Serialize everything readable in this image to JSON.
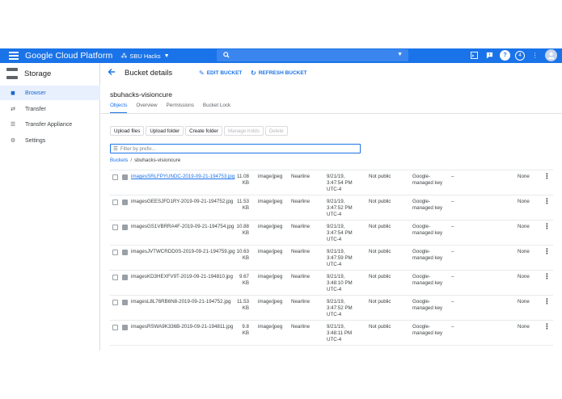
{
  "topbar": {
    "brand": "Google Cloud Platform",
    "project": "SBU Hacks",
    "notification_count": "4"
  },
  "sidebar": {
    "product_title": "Storage",
    "items": [
      {
        "label": "Browser",
        "icon": "bucket-icon",
        "active": true
      },
      {
        "label": "Transfer",
        "icon": "transfer-icon",
        "active": false
      },
      {
        "label": "Transfer Appliance",
        "icon": "appliance-icon",
        "active": false
      },
      {
        "label": "Settings",
        "icon": "gear-icon",
        "active": false
      }
    ]
  },
  "header": {
    "title": "Bucket details",
    "edit_label": "EDIT BUCKET",
    "refresh_label": "REFRESH BUCKET"
  },
  "bucket": {
    "name": "sbuhacks-visioncure"
  },
  "tabs": [
    {
      "label": "Objects",
      "active": true
    },
    {
      "label": "Overview",
      "active": false
    },
    {
      "label": "Permissions",
      "active": false
    },
    {
      "label": "Bucket Lock",
      "active": false
    }
  ],
  "actions": {
    "upload_files": "Upload files",
    "upload_folder": "Upload folder",
    "create_folder": "Create folder",
    "manage_holds": "Manage holds",
    "delete": "Delete"
  },
  "filter": {
    "placeholder": "Filter by prefix..."
  },
  "breadcrumb": {
    "root": "Buckets",
    "separator": "/",
    "current": "sbuhacks-visioncure"
  },
  "objects": [
    {
      "name": "imagesSRLFPYUNDC-2019-09-21-194753.jpg",
      "size": "11.08",
      "unit": "KB",
      "type": "image/jpeg",
      "storage": "Nearline",
      "date": "9/21/19,",
      "time": "3:47:54 PM",
      "tz": "UTC-4",
      "public": "Not public",
      "enc1": "Google-",
      "enc2": "managed key",
      "retention": "–",
      "hold": "None"
    },
    {
      "name": "imagesGEESJFD1RY-2019-09-21-194752.jpg",
      "size": "11.53",
      "unit": "KB",
      "type": "image/jpeg",
      "storage": "Nearline",
      "date": "9/21/19,",
      "time": "3:47:52 PM",
      "tz": "UTC-4",
      "public": "Not public",
      "enc1": "Google-",
      "enc2": "managed key",
      "retention": "–",
      "hold": "None"
    },
    {
      "name": "imagesGS1VBRRA4F-2019-09-21-194754.jpg",
      "size": "10.88",
      "unit": "KB",
      "type": "image/jpeg",
      "storage": "Nearline",
      "date": "9/21/19,",
      "time": "3:47:54 PM",
      "tz": "UTC-4",
      "public": "Not public",
      "enc1": "Google-",
      "enc2": "managed key",
      "retention": "–",
      "hold": "None"
    },
    {
      "name": "imagesJVTWCRDD0S-2019-09-21-194759.jpg",
      "size": "10.63",
      "unit": "KB",
      "type": "image/jpeg",
      "storage": "Nearline",
      "date": "9/21/19,",
      "time": "3:47:59 PM",
      "tz": "UTC-4",
      "public": "Not public",
      "enc1": "Google-",
      "enc2": "managed key",
      "retention": "–",
      "hold": "None"
    },
    {
      "name": "imagesKD3HEXFV9T-2019-09-21-194810.jpg",
      "size": "9.67",
      "unit": "KB",
      "type": "image/jpeg",
      "storage": "Nearline",
      "date": "9/21/19,",
      "time": "3:48:10 PM",
      "tz": "UTC-4",
      "public": "Not public",
      "enc1": "Google-",
      "enc2": "managed key",
      "retention": "–",
      "hold": "None"
    },
    {
      "name": "imagesL8L76RB6N8-2019-09-21-194752.jpg",
      "size": "11.53",
      "unit": "KB",
      "type": "image/jpeg",
      "storage": "Nearline",
      "date": "9/21/19,",
      "time": "3:47:52 PM",
      "tz": "UTC-4",
      "public": "Not public",
      "enc1": "Google-",
      "enc2": "managed key",
      "retention": "–",
      "hold": "None"
    },
    {
      "name": "imagesRSWA9K336B-2019-09-21-194811.jpg",
      "size": "9.8",
      "unit": "KB",
      "type": "image/jpeg",
      "storage": "Nearline",
      "date": "9/21/19,",
      "time": "3:48:11 PM",
      "tz": "UTC-4",
      "public": "Not public",
      "enc1": "Google-",
      "enc2": "managed key",
      "retention": "–",
      "hold": "None"
    }
  ],
  "colors": {
    "accent": "#1a73e8",
    "active_nav_bg": "#e8f0fe"
  }
}
